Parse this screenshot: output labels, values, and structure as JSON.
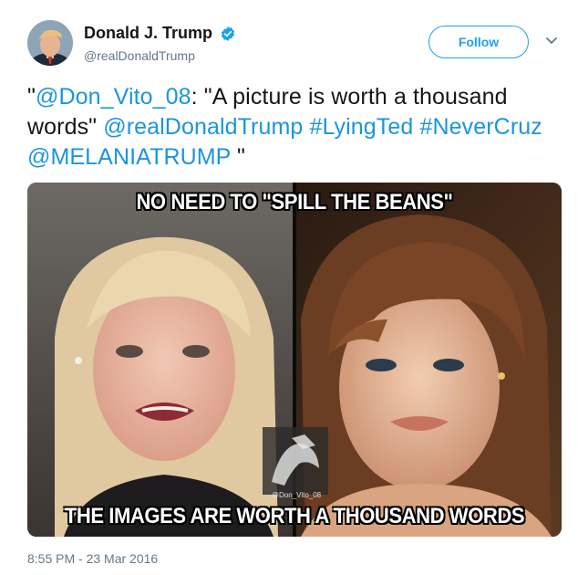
{
  "author": {
    "display_name": "Donald J. Trump",
    "handle": "@realDonaldTrump",
    "verified_icon": "verified-badge-icon",
    "avatar": "profile-photo"
  },
  "actions": {
    "follow_label": "Follow",
    "menu_icon": "chevron-down-icon"
  },
  "tweet": {
    "t1": "\"",
    "mention1": "@Don_Vito_08",
    "t2": ": \"A picture is worth a thousand words\" ",
    "mention2": "@realDonaldTrump",
    "t3": " ",
    "hashtag1": "#LyingTed",
    "t4": " ",
    "hashtag2": "#NeverCruz",
    "t5": "  ",
    "mention3": "@MELANIATRUMP",
    "t6": " \""
  },
  "media": {
    "caption_top": "NO NEED TO \"SPILL THE BEANS\"",
    "caption_bottom": "THE IMAGES ARE WORTH A THOUSAND WORDS",
    "watermark": "@Don_Vito_08"
  },
  "timestamp": "8:55 PM - 23 Mar 2016",
  "colors": {
    "link": "#1b95e0",
    "accent": "#1da1f2",
    "secondary_text": "#657786"
  }
}
